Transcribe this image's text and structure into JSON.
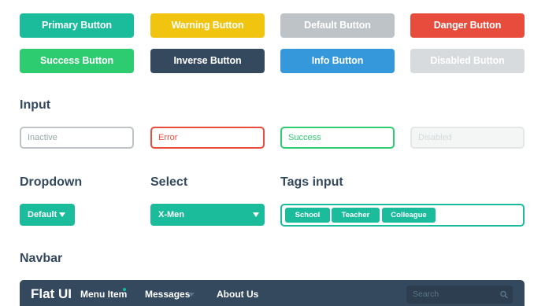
{
  "colors": {
    "primary": "#1abc9c",
    "warning": "#f1c40f",
    "default": "#bdc3c7",
    "danger": "#e74c3c",
    "success": "#2ecc71",
    "inverse": "#34495e",
    "info": "#3498db",
    "disabled": "#d7dbdd",
    "navbar": "#34495e",
    "text": "#34495e"
  },
  "buttons": {
    "primary": "Primary Button",
    "warning": "Warning Button",
    "default": "Default Button",
    "danger": "Danger Button",
    "success": "Success Button",
    "inverse": "Inverse Button",
    "info": "Info Button",
    "disabled": "Disabled Button"
  },
  "input": {
    "title": "Input",
    "inactive_placeholder": "Inactive",
    "error_placeholder": "Error",
    "success_placeholder": "Success",
    "disabled_placeholder": "Disabled"
  },
  "dropdown": {
    "title": "Dropdown",
    "label": "Default"
  },
  "select": {
    "title": "Select",
    "value": "X-Men"
  },
  "tags_input": {
    "title": "Tags input",
    "tags": [
      "School",
      "Teacher",
      "Colleague"
    ]
  },
  "navbar": {
    "title": "Navbar",
    "brand": "Flat UI",
    "items": [
      "Menu Item",
      "Messages",
      "About Us"
    ],
    "search_placeholder": "Search",
    "icons": {
      "search": "search-icon",
      "new_indicator": "dot-indicator"
    }
  }
}
